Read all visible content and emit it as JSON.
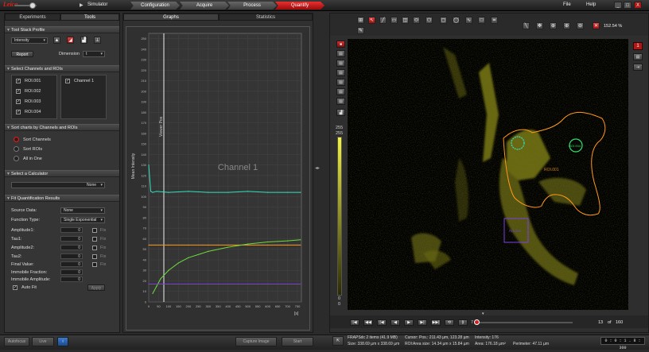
{
  "topbar": {
    "simulator_label": "Simulator",
    "steps": [
      "Configuration",
      "Acquire",
      "Process",
      "Quantify"
    ],
    "active_step": "Quantify",
    "menu": [
      "File",
      "Help"
    ],
    "win_buttons": [
      "_",
      "□",
      "X"
    ]
  },
  "left": {
    "tabs": [
      "Experiments",
      "Tools"
    ],
    "tool_stack": {
      "title": "Tool Stack Profile",
      "mode": "Intensity",
      "report_label": "Report",
      "dimension_label": "Dimension",
      "dimension_value": "t"
    },
    "channels": {
      "title": "Select Channels and ROIs",
      "rois": [
        "ROI.001",
        "ROI.002",
        "ROI.003",
        "ROI.004"
      ],
      "channel": "Channel 1"
    },
    "sort": {
      "title": "Sort charts by Channels and ROIs",
      "options": [
        "Sort Channels",
        "Sort ROIs",
        "All in One"
      ]
    },
    "calculator": {
      "title": "Select a Calculator",
      "value": "None"
    },
    "fit": {
      "title": "Fit Quantification Results",
      "source_label": "Source Data:",
      "source_value": "None",
      "function_label": "Function Type:",
      "function_value": "Single Exponential",
      "params": [
        {
          "label": "Amplitude1:",
          "value": "0",
          "fix": "Fix"
        },
        {
          "label": "Tau1:",
          "value": "0",
          "fix": "Fix"
        },
        {
          "label": "Amplitude2:",
          "value": "0",
          "fix": "Fix"
        },
        {
          "label": "Tau2:",
          "value": "0",
          "fix": "Fix"
        },
        {
          "label": "Final Value:",
          "value": "0",
          "fix": "Fix"
        },
        {
          "label": "Immobile Fraction:",
          "value": "0"
        },
        {
          "label": "Immobile Amplitude:",
          "value": "0"
        }
      ],
      "autofit_label": "Auto Fit",
      "apply_label": "Apply"
    }
  },
  "center": {
    "tabs": [
      "Graphs",
      "Statistics"
    ],
    "chart_title": "Channel 1",
    "marker_label": "Viewer Pos",
    "xunit": "[s]"
  },
  "chart_data": {
    "type": "line",
    "title": "Channel 1",
    "ylabel": "Mean Intensity",
    "xlabel": "[s]",
    "xlim": [
      0,
      770
    ],
    "ylim": [
      0,
      255
    ],
    "yticks": [
      0,
      10,
      20,
      30,
      40,
      50,
      60,
      70,
      80,
      90,
      100,
      110,
      120,
      130,
      140,
      150,
      160,
      170,
      180,
      190,
      200,
      210,
      220,
      230,
      240,
      250
    ],
    "xticks": [
      0,
      50,
      100,
      150,
      200,
      250,
      300,
      350,
      400,
      450,
      500,
      550,
      600,
      650,
      700,
      750
    ],
    "series": [
      {
        "color": "#33e0c0",
        "x": [
          0,
          10,
          20,
          40,
          100,
          200,
          300,
          400,
          500,
          600,
          700,
          765
        ],
        "y": [
          130,
          105,
          104,
          105,
          104,
          105,
          104,
          104,
          105,
          104,
          104,
          104
        ]
      },
      {
        "color": "#ff9a1a",
        "x": [
          0,
          100,
          200,
          300,
          400,
          500,
          600,
          700,
          765
        ],
        "y": [
          54,
          54,
          54,
          54,
          54,
          54,
          54,
          54,
          54
        ]
      },
      {
        "color": "#6ddc3a",
        "x": [
          20,
          40,
          60,
          100,
          150,
          200,
          300,
          400,
          500,
          600,
          700,
          765
        ],
        "y": [
          8,
          15,
          22,
          30,
          37,
          42,
          48,
          52,
          55,
          57,
          58,
          59
        ]
      },
      {
        "color": "#7a40d0",
        "x": [
          0,
          100,
          200,
          300,
          400,
          500,
          600,
          700,
          765
        ],
        "y": [
          17,
          17,
          17,
          17,
          17,
          17,
          17,
          17,
          17
        ]
      }
    ]
  },
  "viewer": {
    "zoom": "152.54 %",
    "scale_max": "255",
    "scale_min": "0",
    "roi_labels": [
      "ROI.001",
      "ROI.004",
      "ROI.002"
    ],
    "series_num": "1"
  },
  "player": {
    "frame_value": "7",
    "frame_current": "13",
    "frame_of": "of",
    "frame_total": "160"
  },
  "status": {
    "file": "FRAPSdc 2 items (41.9 MB)",
    "size": "Size: 338.69 µm x 338.69 µm",
    "cursor": "Cursor:",
    "pos": "Pos.: 211.43 µm, 123.28 µm",
    "roi": "ROI:",
    "area_size": "Area size: 14.34 µm x 15.84 µm",
    "intensity": "Intensity: 176",
    "area": "Area: 176.18 µm²",
    "perimeter": "Perimeter: 47.11 µm",
    "time": "0 : 0 : 1 . 8 : 300"
  },
  "bottom": {
    "buttons": [
      "Autofocus",
      "Live",
      "Capture Image",
      "Start"
    ]
  }
}
